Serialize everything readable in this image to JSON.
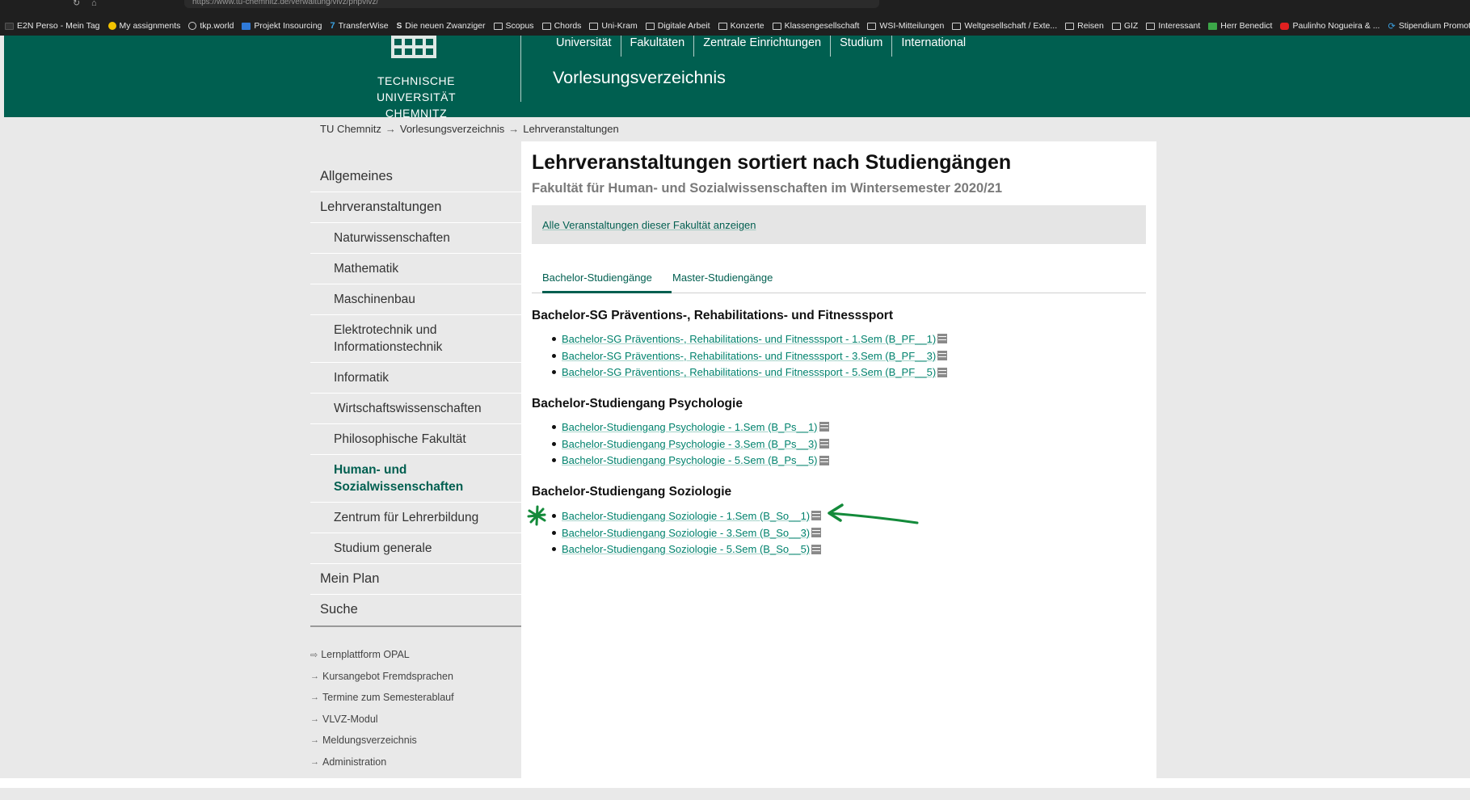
{
  "browser": {
    "url": "https://www.tu-chemnitz.de/verwaltung/vlvz/phpvlvz/",
    "bookmarks": [
      {
        "label": "E2N Perso - Mein Tag",
        "icon": "dark-icon"
      },
      {
        "label": "My assignments",
        "icon": "yellow-icon"
      },
      {
        "label": "tkp.world",
        "icon": "globe-icon"
      },
      {
        "label": "Projekt Insourcing",
        "icon": "folder-icon"
      },
      {
        "label": "TransferWise",
        "icon": "transferwise-icon"
      },
      {
        "label": "Die neuen Zwanziger",
        "icon": "s-icon"
      },
      {
        "label": "Scopus",
        "icon": "folder-icon"
      },
      {
        "label": "Chords",
        "icon": "folder-icon"
      },
      {
        "label": "Uni-Kram",
        "icon": "folder-icon"
      },
      {
        "label": "Digitale Arbeit",
        "icon": "folder-icon"
      },
      {
        "label": "Konzerte",
        "icon": "folder-icon"
      },
      {
        "label": "Klassengesellschaft",
        "icon": "folder-icon"
      },
      {
        "label": "WSI-Mitteilungen",
        "icon": "folder-icon"
      },
      {
        "label": "Weltgesellschaft / Exte...",
        "icon": "folder-icon"
      },
      {
        "label": "Reisen",
        "icon": "folder-icon"
      },
      {
        "label": "GIZ",
        "icon": "folder-icon"
      },
      {
        "label": "Interessant",
        "icon": "folder-icon"
      },
      {
        "label": "Herr Benedict",
        "icon": "h-icon"
      },
      {
        "label": "Paulinho Nogueira & ...",
        "icon": "youtube-icon"
      },
      {
        "label": "Stipendium Promotion",
        "icon": "link-icon"
      }
    ]
  },
  "header": {
    "logo_line1": "TECHNISCHE UNIVERSITÄT",
    "logo_line2": "CHEMNITZ",
    "nav": [
      "Universität",
      "Fakultäten",
      "Zentrale Einrichtungen",
      "Studium",
      "International"
    ],
    "title": "Vorlesungsverzeichnis"
  },
  "breadcrumb": [
    "TU Chemnitz",
    "Vorlesungsverzeichnis",
    "Lehrveranstaltungen"
  ],
  "sidebar": {
    "items": [
      {
        "label": "Allgemeines"
      },
      {
        "label": "Lehrveranstaltungen"
      }
    ],
    "subitems": [
      "Naturwissenschaften",
      "Mathematik",
      "Maschinenbau",
      "Elektrotechnik und Informationstechnik",
      "Informatik",
      "Wirtschaftswissenschaften",
      "Philosophische Fakultät",
      "Human- und Sozialwissenschaften",
      "Zentrum für Lehrerbildung",
      "Studium generale"
    ],
    "bottom_items": [
      "Mein Plan",
      "Suche"
    ],
    "links": [
      "Lernplattform OPAL",
      "Kursangebot Fremdsprachen",
      "Termine zum Semesterablauf",
      "VLVZ-Modul",
      "Meldungsverzeichnis",
      "Administration"
    ]
  },
  "main": {
    "title": "Lehrveranstaltungen sortiert nach Studiengängen",
    "subtitle": "Fakultät für Human- und Sozialwissenschaften im Wintersemester 2020/21",
    "all_link": "Alle Veranstaltungen dieser Fakultät anzeigen",
    "tabs": [
      "Bachelor-Studiengänge",
      "Master-Studiengänge"
    ],
    "sections": [
      {
        "title": "Bachelor-SG Präventions-, Rehabilitations- und Fitnesssport",
        "items": [
          "Bachelor-SG Präventions-, Rehabilitations- und Fitnesssport - 1.Sem (B_PF__1)",
          "Bachelor-SG Präventions-, Rehabilitations- und Fitnesssport - 3.Sem (B_PF__3)",
          "Bachelor-SG Präventions-, Rehabilitations- und Fitnesssport - 5.Sem (B_PF__5)"
        ]
      },
      {
        "title": "Bachelor-Studiengang Psychologie",
        "items": [
          "Bachelor-Studiengang Psychologie - 1.Sem (B_Ps__1)",
          "Bachelor-Studiengang Psychologie - 3.Sem (B_Ps__3)",
          "Bachelor-Studiengang Psychologie - 5.Sem (B_Ps__5)"
        ]
      },
      {
        "title": "Bachelor-Studiengang Soziologie",
        "items": [
          "Bachelor-Studiengang Soziologie - 1.Sem (B_So__1)",
          "Bachelor-Studiengang Soziologie - 3.Sem (B_So__3)",
          "Bachelor-Studiengang Soziologie - 5.Sem (B_So__5)"
        ]
      }
    ]
  },
  "colors": {
    "brand": "#005f50",
    "link": "#00826d",
    "annotation": "#138a3a"
  }
}
